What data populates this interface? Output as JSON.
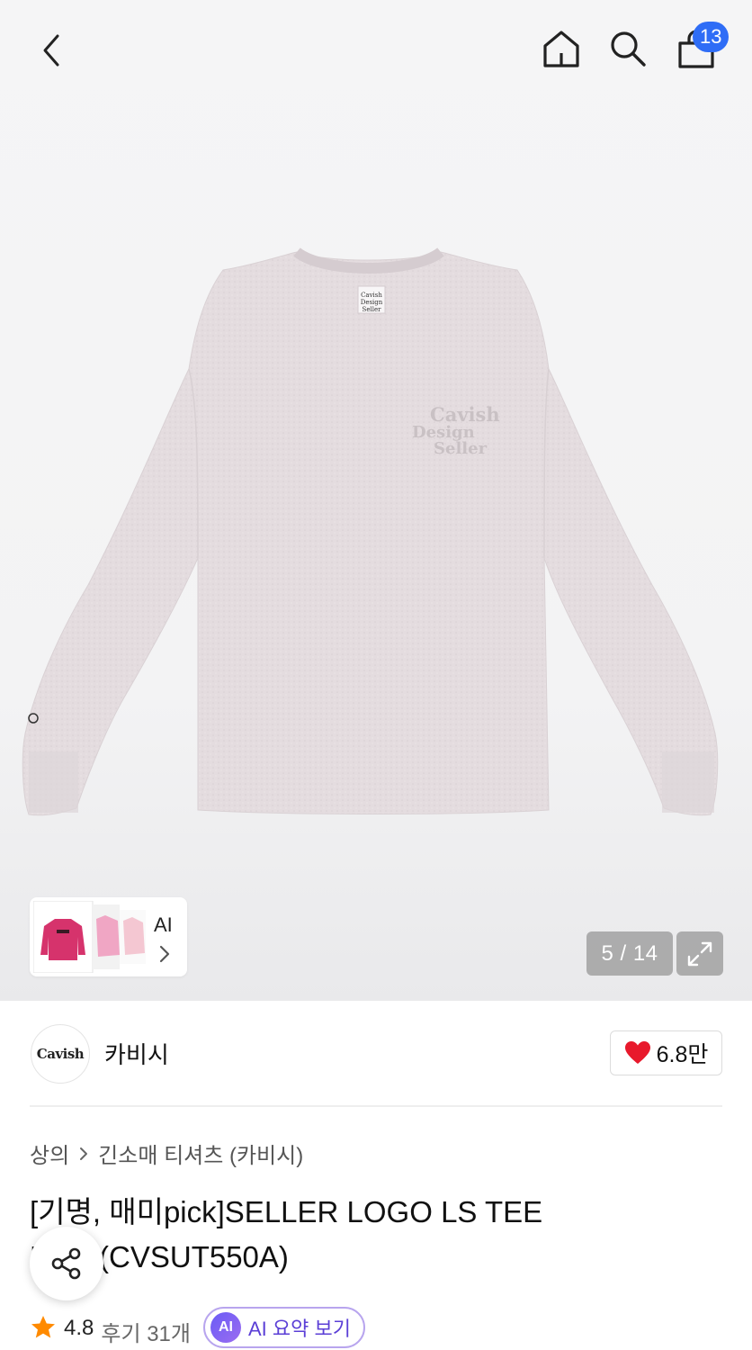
{
  "header": {
    "cart_count": "13"
  },
  "gallery": {
    "counter": "5 / 14",
    "ai_label": "AI",
    "photo_logo_lines": [
      "Cavish",
      "Design",
      "Seller"
    ]
  },
  "brand": {
    "logo_text": "Cavish",
    "name": "카비시",
    "likes": "6.8만"
  },
  "breadcrumb": {
    "category": "상의",
    "subcategory": "긴소매 티셔츠 (카비시)"
  },
  "product": {
    "title": "[기명, 매미pick]SELLER LOGO LS TEE PINK(CVSUT550A)"
  },
  "rating": {
    "score": "4.8",
    "reviews": "후기 31개",
    "ai_summary_label": "AI 요약 보기",
    "ai_badge": "AI"
  },
  "colors": {
    "accent_blue": "#2f6df6",
    "heart_red": "#e8192c",
    "star_orange": "#ff8a00",
    "ai_purple": "#5b3fd6",
    "shirt_pink": "#e5dde0"
  },
  "icons": {
    "back": "chevron-left-icon",
    "home": "home-icon",
    "search": "search-icon",
    "cart": "shopping-bag-icon",
    "expand": "expand-icon",
    "like": "heart-icon",
    "share": "share-icon",
    "star": "star-icon"
  }
}
